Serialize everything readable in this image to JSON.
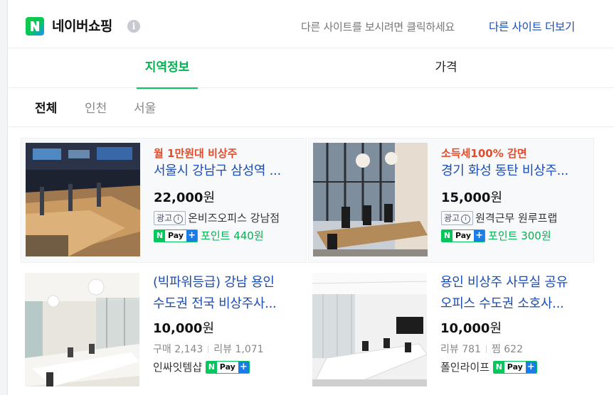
{
  "header": {
    "brand": "네이버쇼핑",
    "info_icon": "i",
    "hint": "다른 사이트를 보시려면 클릭하세요",
    "more_link": "다른 사이트 더보기"
  },
  "tabs": [
    {
      "label": "지역정보",
      "active": true
    },
    {
      "label": "가격",
      "active": false
    }
  ],
  "subtabs": [
    {
      "label": "전체",
      "active": true
    },
    {
      "label": "인천",
      "active": false
    },
    {
      "label": "서울",
      "active": false
    }
  ],
  "colors": {
    "naver_green": "#03c75a",
    "link_blue": "#1a4db5",
    "promo_red": "#e34c2a"
  },
  "products": [
    {
      "promo": "월 1만원대 비상주",
      "title": "서울시 강남구 삼성역 ...",
      "price": "22,000",
      "currency": "원",
      "ad_label": "광고",
      "ad_info": "i",
      "seller": "온비즈오피스 강남점",
      "npay_n": "N",
      "npay_text": "Pay",
      "npay_plus": "+",
      "point": "포인트 440원"
    },
    {
      "promo": "소득세100% 감면",
      "title": "경기 화성 동탄 비상주...",
      "price": "15,000",
      "currency": "원",
      "ad_label": "광고",
      "ad_info": "i",
      "seller": "원격근무 원루프랩",
      "npay_n": "N",
      "npay_text": "Pay",
      "npay_plus": "+",
      "point": "포인트 300원"
    },
    {
      "title_line1": "(빅파워등급) 강남 용인",
      "title_line2": "수도권 전국 비상주사...",
      "price": "10,000",
      "currency": "원",
      "stat1": "구매 2,143",
      "stat2": "리뷰 1,071",
      "seller": "인싸잇템샵",
      "npay_n": "N",
      "npay_text": "Pay",
      "npay_plus": "+"
    },
    {
      "title_line1": "용인 비상주 사무실 공유",
      "title_line2": "오피스 수도권 소호사...",
      "price": "10,000",
      "currency": "원",
      "stat1": "리뷰 781",
      "stat2": "찜 622",
      "seller": "폴인라이프",
      "npay_n": "N",
      "npay_text": "Pay",
      "npay_plus": "+"
    }
  ]
}
